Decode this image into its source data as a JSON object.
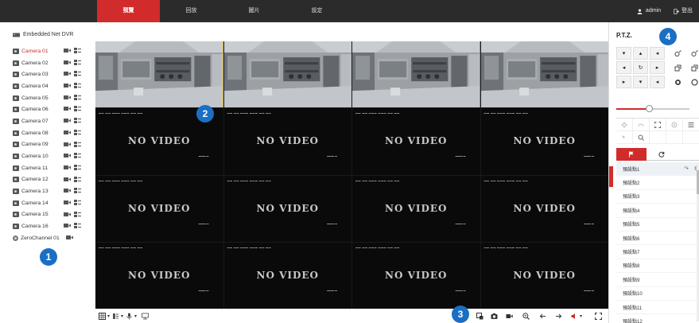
{
  "topbar": {
    "tabs": [
      {
        "label": "預覽",
        "active": true
      },
      {
        "label": "回放",
        "active": false
      },
      {
        "label": "圖片",
        "active": false
      },
      {
        "label": "設定",
        "active": false
      }
    ],
    "user": "admin",
    "logout": "登出"
  },
  "device_tree": {
    "dvr_name": "Embedded Net DVR",
    "cameras": [
      {
        "label": "Camera 01",
        "active": true
      },
      {
        "label": "Camera 02"
      },
      {
        "label": "Camera 03"
      },
      {
        "label": "Camera 04"
      },
      {
        "label": "Camera 05"
      },
      {
        "label": "Camera 06"
      },
      {
        "label": "Camera 07"
      },
      {
        "label": "Camera 08"
      },
      {
        "label": "Camera 09"
      },
      {
        "label": "Camera 10"
      },
      {
        "label": "Camera 11"
      },
      {
        "label": "Camera 12"
      },
      {
        "label": "Camera 13"
      },
      {
        "label": "Camera 14"
      },
      {
        "label": "Camera 15"
      },
      {
        "label": "Camera 16"
      }
    ],
    "zero_channel": "ZeroChannel 01"
  },
  "video": {
    "no_video_text": "NO VIDEO",
    "live_cells": 4,
    "total_cells": 16
  },
  "ptz": {
    "title": "P.T.Z.",
    "directions": [
      "▾",
      "▴",
      "◂",
      "◂",
      "↻",
      "▸",
      "▸",
      "▾",
      "◂"
    ],
    "speed_level": 0.45,
    "presets": [
      "預設點1",
      "預設點2",
      "預設點3",
      "預設點4",
      "預設點5",
      "預設點6",
      "預設點7",
      "預設點8",
      "預設點9",
      "預設點10",
      "預設點11",
      "預設點12"
    ]
  },
  "badges": [
    "1",
    "2",
    "3",
    "4"
  ],
  "colors": {
    "accent": "#d22b2b",
    "topbar": "#2b2b2b",
    "badge": "#1a6fc4",
    "selected_border": "#e6b800"
  }
}
